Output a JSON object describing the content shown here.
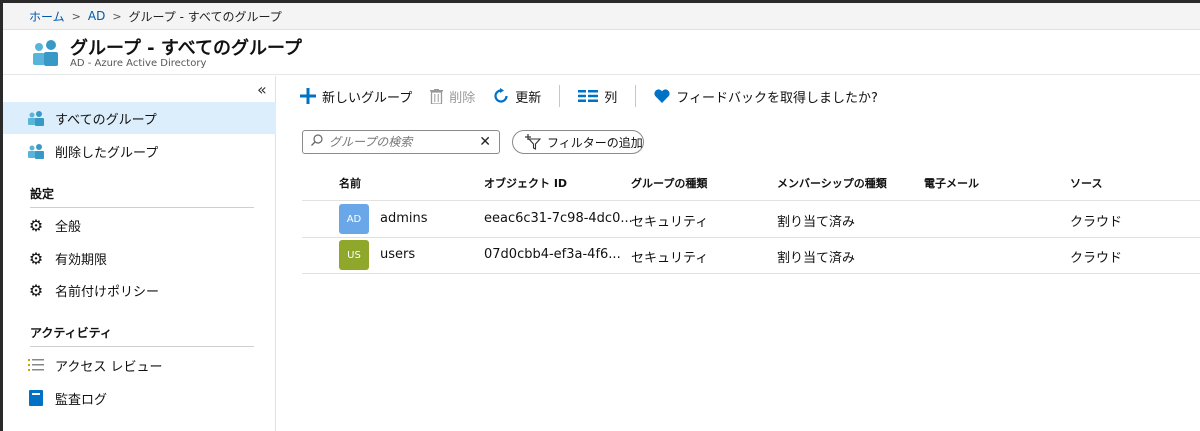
{
  "breadcrumb": {
    "home": "ホーム",
    "ad": "AD",
    "current": "グループ - すべてのグループ"
  },
  "header": {
    "title": "グループ - すべてのグループ",
    "subtitle": "AD - Azure Active Directory"
  },
  "sidebar": {
    "collapse": "«",
    "items": [
      {
        "label": "すべてのグループ",
        "icon": "users-icon",
        "active": true
      },
      {
        "label": "削除したグループ",
        "icon": "users-icon",
        "active": false
      }
    ],
    "settings_title": "設定",
    "settings": [
      {
        "label": "全般",
        "icon": "gear-icon"
      },
      {
        "label": "有効期限",
        "icon": "gear-icon"
      },
      {
        "label": "名前付けポリシー",
        "icon": "gear-icon"
      }
    ],
    "activity_title": "アクティビティ",
    "activity": [
      {
        "label": "アクセス レビュー",
        "icon": "list-icon"
      },
      {
        "label": "監査ログ",
        "icon": "book-icon"
      }
    ]
  },
  "toolbar": {
    "new_group": "新しいグループ",
    "delete": "削除",
    "refresh": "更新",
    "columns": "列",
    "feedback": "フィードバックを取得しましたか?"
  },
  "search": {
    "placeholder": "グループの検索"
  },
  "filter": {
    "label": "フィルターの追加"
  },
  "table": {
    "headers": [
      "名前",
      "オブジェクト ID",
      "グループの種類",
      "メンバーシップの種類",
      "電子メール",
      "ソース"
    ],
    "rows": [
      {
        "initials": "AD",
        "name": "admins",
        "object_id": "eeac6c31-7c98-4dc0...",
        "group_type": "セキュリティ",
        "membership": "割り当て済み",
        "email": "",
        "source": "クラウド",
        "avatar_color": "#6aa7e8"
      },
      {
        "initials": "US",
        "name": "users",
        "object_id": "07d0cbb4-ef3a-4f6...",
        "group_type": "セキュリティ",
        "membership": "割り当て済み",
        "email": "",
        "source": "クラウド",
        "avatar_color": "#8fa82c"
      }
    ]
  },
  "colors": {
    "accent": "#0058ad",
    "active_bg": "#dceefb"
  }
}
